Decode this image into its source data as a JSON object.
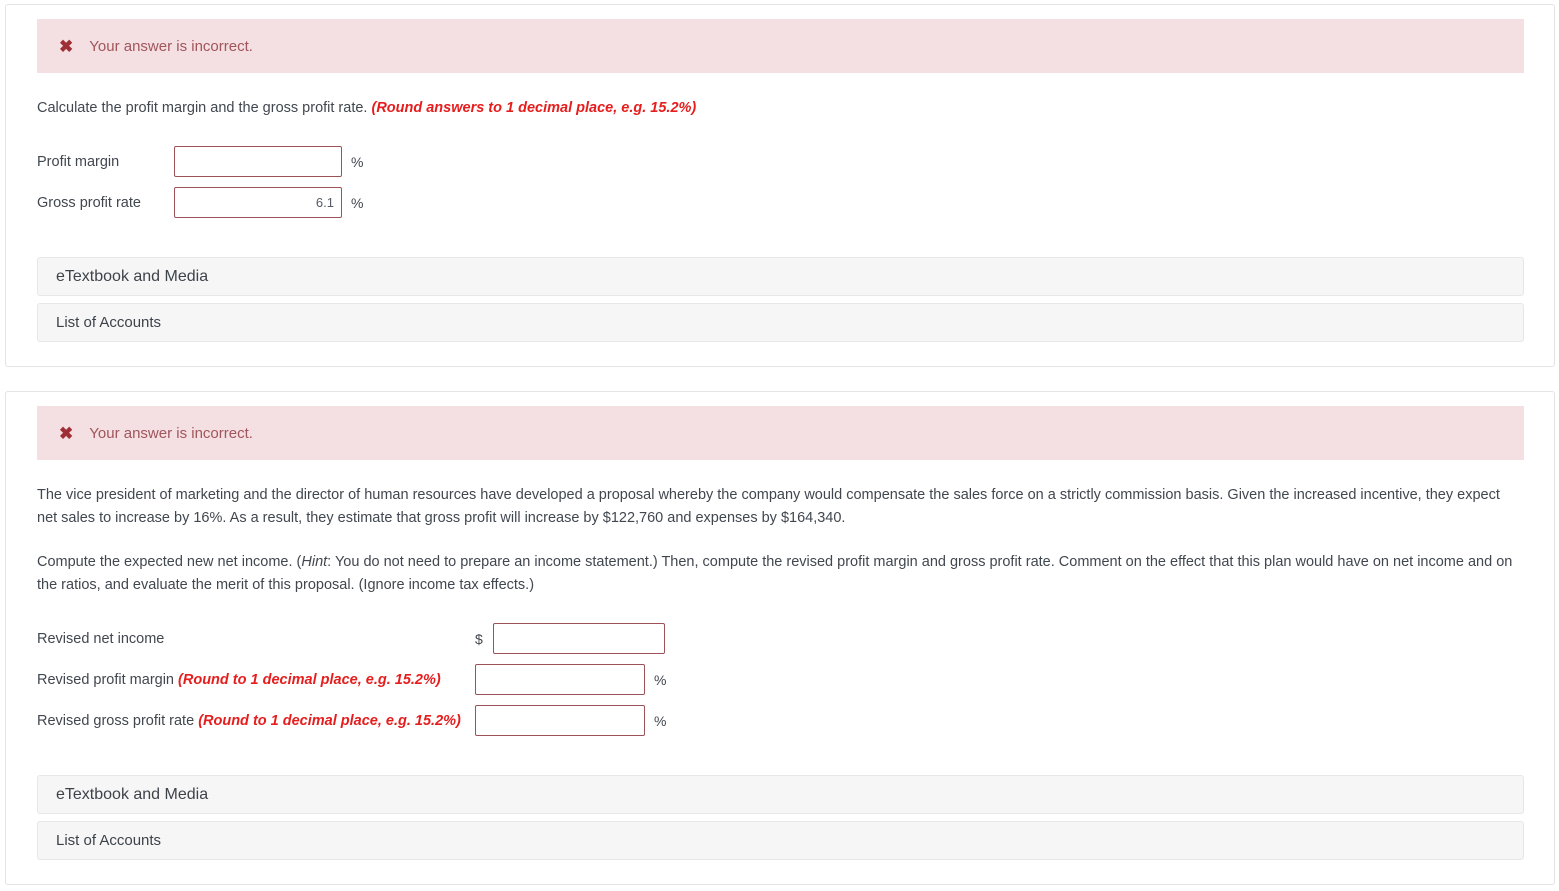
{
  "section1": {
    "alert": {
      "icon": "x-mark-icon",
      "glyph": "✖",
      "text": "Your answer is incorrect."
    },
    "prompt": {
      "main": "Calculate the profit margin and the gross profit rate. ",
      "hint": "(Round answers to 1 decimal place, e.g. 15.2%)"
    },
    "fields": [
      {
        "label": "Profit margin",
        "value": "",
        "unit": "%"
      },
      {
        "label": "Gross profit rate",
        "value": "6.1",
        "unit": "%"
      }
    ],
    "tools": [
      {
        "label": "eTextbook and Media"
      },
      {
        "label": "List of Accounts"
      }
    ]
  },
  "section2": {
    "alert": {
      "icon": "x-mark-icon",
      "glyph": "✖",
      "text": "Your answer is incorrect."
    },
    "paragraph1": "The vice president of marketing and the director of human resources have developed a proposal whereby the company would compensate the sales force on a strictly commission basis. Given the increased incentive, they expect net sales to increase by 16%. As a result, they estimate that gross profit will increase by $122,760 and expenses by $164,340.",
    "paragraph2": {
      "before": "Compute the expected new net income. (",
      "italic": "Hint",
      "after": ": You do not need to prepare an income statement.) Then, compute the revised profit margin and gross profit rate. Comment on the effect that this plan would have on net income and on the ratios, and evaluate the merit of this proposal. (Ignore income tax effects.)"
    },
    "fields": [
      {
        "label": "Revised net income",
        "hint": "",
        "currency": "$",
        "value": "",
        "unit": ""
      },
      {
        "label": "Revised profit margin ",
        "hint": "(Round to 1 decimal place, e.g. 15.2%)",
        "currency": "",
        "value": "",
        "unit": "%"
      },
      {
        "label": "Revised gross profit rate ",
        "hint": "(Round to 1 decimal place, e.g. 15.2%)",
        "currency": "",
        "value": "",
        "unit": "%"
      }
    ],
    "tools": [
      {
        "label": "eTextbook and Media"
      },
      {
        "label": "List of Accounts"
      }
    ]
  },
  "colors": {
    "alert_background": "#f4dfe2",
    "alert_text": "#a1555c",
    "alert_icon": "#9e2f36",
    "hint_red": "#e61d1d",
    "input_border": "#9b5259",
    "body_text": "#41474f",
    "tool_background": "#f6f6f6"
  }
}
